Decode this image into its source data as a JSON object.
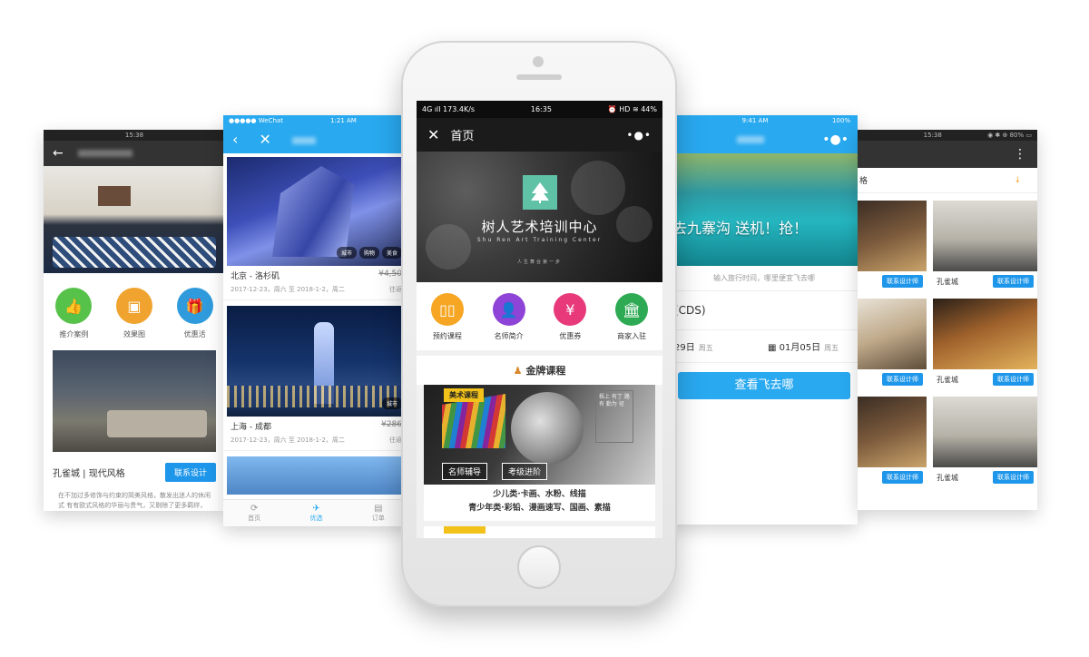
{
  "left_screen": {
    "status_time": "15:38",
    "icons": [
      {
        "label": "推介案例",
        "icon": "thumbs-up-icon",
        "color": "#57c24a"
      },
      {
        "label": "效果图",
        "icon": "picture-icon",
        "color": "#f0a32e"
      },
      {
        "label": "优惠活",
        "icon": "gift-icon",
        "color": "#2f9bdc"
      }
    ],
    "case_title": "孔雀城 | 现代风格",
    "contact_button": "联系设计",
    "description": "在不加过多修饰与约束的简美风格，散发出迷人的休闲式 有有欧式风格的华丽与贵气，又剔除了更多羁绊，同时又摒 化根基的新的怀旧，贵气而不失自在与随意。"
  },
  "travel_screen": {
    "carrier": "●●●●● WeChat",
    "time": "1:21 AM",
    "routes": [
      {
        "title": "北京 - 洛杉矶",
        "price": "¥4,50",
        "dates": "2017-12-23，周六 至 2018-1-2，周二",
        "extra": "往返",
        "tags": [
          "城市",
          "购物",
          "美食"
        ]
      },
      {
        "title": "上海 - 成都",
        "price": "¥286",
        "dates": "2017-12-23，周六 至 2018-1-2，周二",
        "extra": "往返",
        "tags": [
          "城市"
        ]
      }
    ],
    "tabs": [
      {
        "label": "首页",
        "glyph": "⟳"
      },
      {
        "label": "优选",
        "glyph": "✈"
      },
      {
        "label": "订单",
        "glyph": "▤"
      }
    ]
  },
  "center_phone": {
    "status": {
      "network": "4G ıll  173.4K/s",
      "time": "16:35",
      "right": "⏰ HD ≋ 44%"
    },
    "nav_title": "首页",
    "brand_cn": "树人艺术培训中心",
    "brand_en": "Shu Ren Art Training Center",
    "slogan": "人生舞台第一步",
    "menu": [
      {
        "label": "预约课程",
        "icon": "book-icon",
        "color": "#f6a623"
      },
      {
        "label": "名师简介",
        "icon": "teacher-icon",
        "color": "#8e44d6"
      },
      {
        "label": "优惠券",
        "icon": "coupon-icon",
        "color": "#e8397b"
      },
      {
        "label": "商家入驻",
        "icon": "building-icon",
        "color": "#2eaa54"
      }
    ],
    "section_title": "金牌课程",
    "course": {
      "tag": "美术课程",
      "pill_left": "名师辅导",
      "pill_right": "考级进阶",
      "note": "梧上 有丁 路有 勤为 径",
      "line1": "少儿类·卡画、水粉、线描",
      "line2": "青少年类·彩铅、漫画速写、国画、素描"
    }
  },
  "flight_screen": {
    "time": "9:41 AM",
    "battery": "100%",
    "banner_text": "去九寨沟 送机！抢！",
    "hint": "输入旅行时间，哪里便宜飞去哪",
    "origin": "(CDS)",
    "date_from": "29日",
    "date_from_week": "周五",
    "date_to": "01月05日",
    "date_to_week": "周五",
    "search_button": "查看飞去哪"
  },
  "designer_screen": {
    "status": "15:38",
    "status_right": "◉ ✱ ⊕ 80% ▭",
    "filter_label": "格",
    "cells": [
      {
        "left_label": "",
        "button": "联系设计师"
      },
      {
        "left_label": "孔雀城",
        "button": "联系设计师"
      },
      {
        "left_label": "",
        "button": "联系设计师"
      },
      {
        "left_label": "孔雀城",
        "button": "联系设计师"
      },
      {
        "left_label": "",
        "button": "联系设计师"
      },
      {
        "left_label": "孔雀城",
        "button": "联系设计师"
      }
    ]
  }
}
